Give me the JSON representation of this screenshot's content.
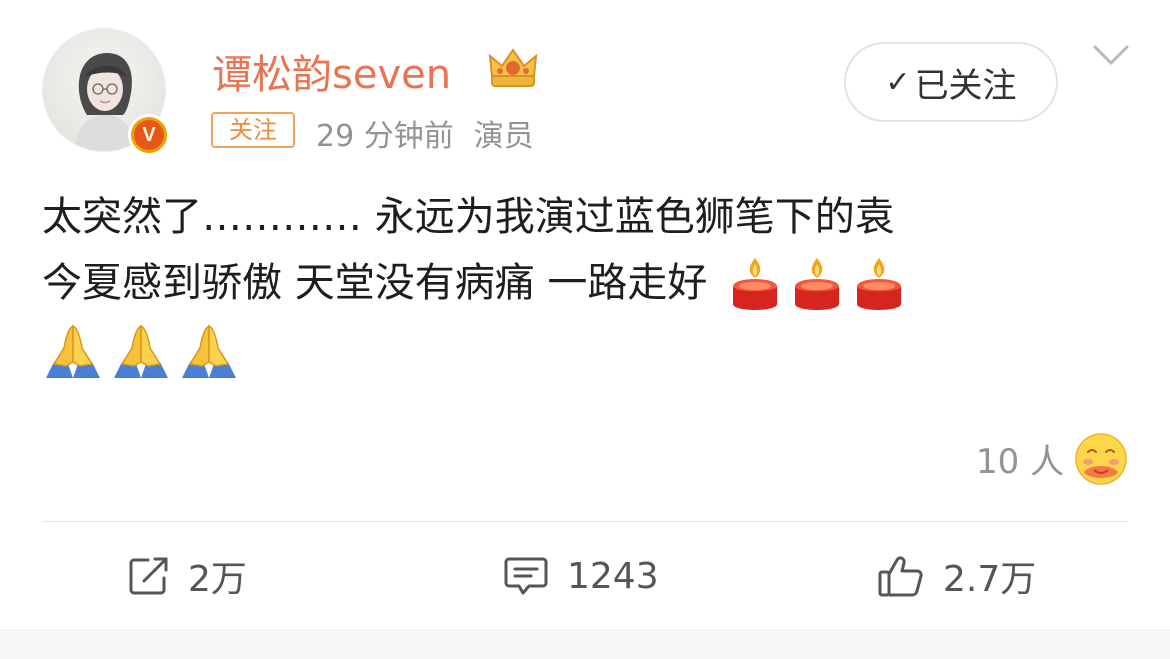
{
  "post": {
    "author": {
      "name": "谭松韵seven",
      "verified_badge": "V"
    },
    "follow_tag": "关注",
    "time": "29 分钟前",
    "role": "演员",
    "followed_button": {
      "check": "✓",
      "label": "已关注"
    },
    "text_lines": [
      "太突然了………… 永远为我演过蓝色狮笔下的袁",
      "今夏感到骄傲 天堂没有病痛 一路走好"
    ],
    "inline_emojis": [
      "candle-icon",
      "candle-icon",
      "candle-icon",
      "pray-icon",
      "pray-icon",
      "pray-icon"
    ],
    "reaction_count": "10 人"
  },
  "actions": {
    "repost": "2万",
    "comment": "1243",
    "like": "2.7万"
  },
  "colors": {
    "username": "#eb7350",
    "tag": "#f08a3a",
    "meta": "#939393",
    "text": "#1e1e1e"
  }
}
